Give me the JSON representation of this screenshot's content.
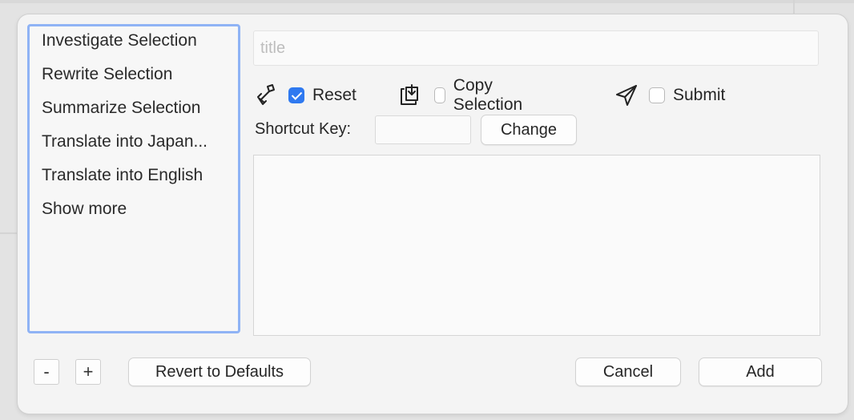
{
  "list": {
    "items": [
      "Investigate Selection",
      "Rewrite Selection",
      "Summarize Selection",
      "Translate into Japan...",
      "Translate into English",
      "Show more"
    ]
  },
  "form": {
    "title_placeholder": "title",
    "reset": {
      "label": "Reset",
      "checked": true,
      "icon": "broom-icon"
    },
    "copy_selection": {
      "label": "Copy Selection",
      "checked": false,
      "icon": "copy-download-icon"
    },
    "submit": {
      "label": "Submit",
      "checked": false,
      "icon": "paper-plane-icon"
    },
    "shortcut_label": "Shortcut Key:",
    "change_label": "Change"
  },
  "footer": {
    "remove_label": "-",
    "add_item_label": "+",
    "revert_label": "Revert to Defaults",
    "cancel_label": "Cancel",
    "add_label": "Add"
  },
  "colors": {
    "accent": "#2f79f0",
    "list_border": "#8fb3f5"
  }
}
